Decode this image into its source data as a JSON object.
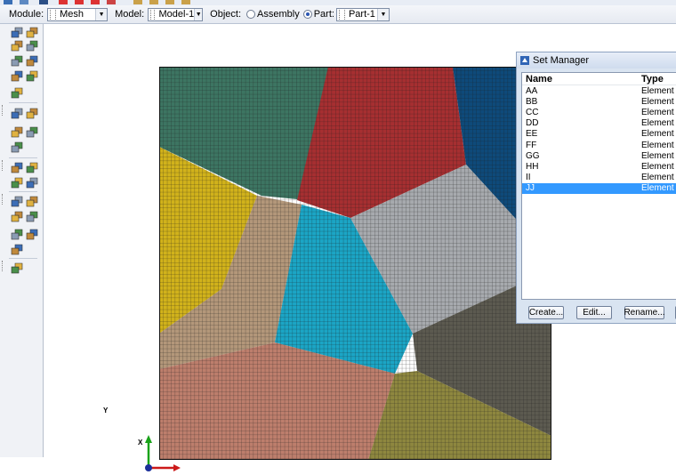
{
  "context_bar": {
    "module_label": "Module:",
    "module_value": "Mesh",
    "model_label": "Model:",
    "model_value": "Model-1",
    "object_label": "Object:",
    "assembly_label": "Assembly",
    "part_label": "Part:",
    "part_value": "Part-1",
    "object_selected": "part"
  },
  "viewport": {
    "triad": {
      "x": "X",
      "y": "Y"
    },
    "mesh_regions": [
      {
        "color": "#3d7562"
      },
      {
        "color": "#a62f31"
      },
      {
        "color": "#0e4a7a"
      },
      {
        "color": "#d1b21b"
      },
      {
        "color": "#b3977a"
      },
      {
        "color": "#1ba5c5"
      },
      {
        "color": "#a7aaae"
      },
      {
        "color": "#5c5a50"
      },
      {
        "color": "#bd7e6c"
      },
      {
        "color": "#8e873f"
      }
    ]
  },
  "set_manager": {
    "title": "Set Manager",
    "columns": {
      "name": "Name",
      "type": "Type"
    },
    "rows": [
      {
        "name": "AA",
        "type": "Element"
      },
      {
        "name": "BB",
        "type": "Element"
      },
      {
        "name": "CC",
        "type": "Element"
      },
      {
        "name": "DD",
        "type": "Element"
      },
      {
        "name": "EE",
        "type": "Element"
      },
      {
        "name": "FF",
        "type": "Element"
      },
      {
        "name": "GG",
        "type": "Element"
      },
      {
        "name": "HH",
        "type": "Element"
      },
      {
        "name": "II",
        "type": "Element"
      },
      {
        "name": "JJ",
        "type": "Element",
        "selected": true
      }
    ],
    "buttons": {
      "create": "Create...",
      "edit": "Edit...",
      "rename": "Rename..."
    }
  }
}
